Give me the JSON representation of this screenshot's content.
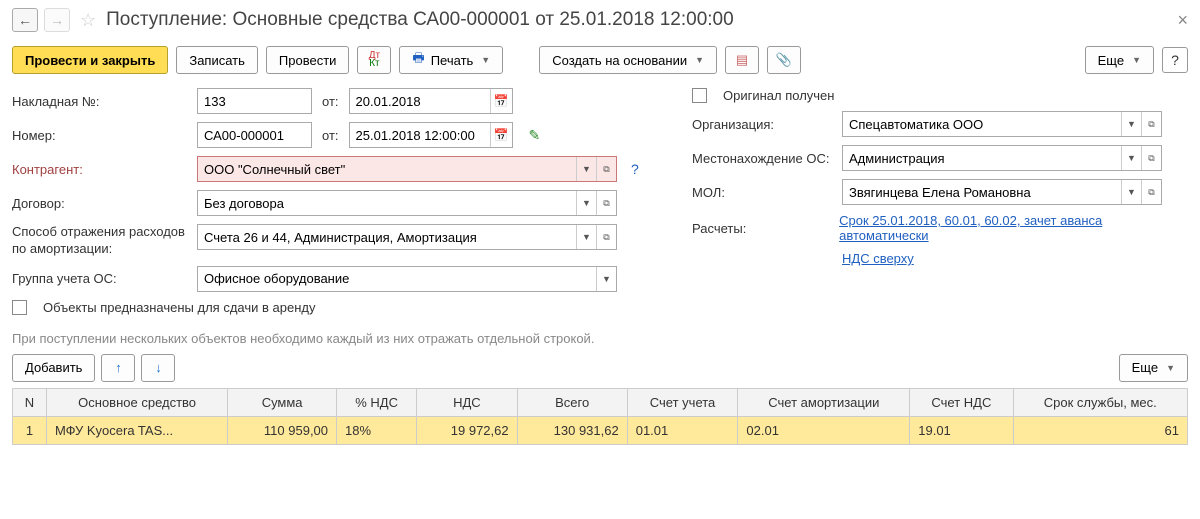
{
  "header": {
    "title": "Поступление: Основные средства СА00-000001 от 25.01.2018 12:00:00"
  },
  "toolbar": {
    "postClose": "Провести и закрыть",
    "save": "Записать",
    "post": "Провести",
    "print": "Печать",
    "createBased": "Создать на основании",
    "more": "Еще"
  },
  "form": {
    "invoiceLabel": "Накладная №:",
    "invoiceNo": "133",
    "fromLabel": "от:",
    "invoiceDate": "20.01.2018",
    "numberLabel": "Номер:",
    "number": "СА00-000001",
    "docDate": "25.01.2018 12:00:00",
    "contractorLabel": "Контрагент:",
    "contractor": "ООО \"Солнечный свет\"",
    "contractLabel": "Договор:",
    "contract": "Без договора",
    "expenseMethodLabel": "Способ отражения расходов по амортизации:",
    "expenseMethod": "Счета 26 и 44, Администрация, Амортизация",
    "osGroupLabel": "Группа учета ОС:",
    "osGroup": "Офисное оборудование",
    "rentCheckbox": "Объекты предназначены для сдачи в аренду",
    "originalLabel": "Оригинал получен",
    "orgLabel": "Организация:",
    "org": "Спецавтоматика ООО",
    "locationLabel": "Местонахождение ОС:",
    "location": "Администрация",
    "molLabel": "МОЛ:",
    "mol": "Звягинцева Елена Романовна",
    "calcLabel": "Расчеты:",
    "calcLink": "Срок 25.01.2018, 60.01, 60.02, зачет аванса автоматически",
    "vatLink": "НДС сверху"
  },
  "hint": "При поступлении нескольких объектов необходимо каждый из них отражать отдельной строкой.",
  "rowToolbar": {
    "add": "Добавить",
    "more": "Еще"
  },
  "table": {
    "headers": {
      "n": "N",
      "asset": "Основное средство",
      "sum": "Сумма",
      "vatPct": "% НДС",
      "vat": "НДС",
      "total": "Всего",
      "acc": "Счет учета",
      "accAmort": "Счет амортизации",
      "accVat": "Счет НДС",
      "life": "Срок службы, мес."
    },
    "rows": [
      {
        "n": "1",
        "asset": "МФУ Kyocera TAS...",
        "sum": "110 959,00",
        "vatPct": "18%",
        "vat": "19 972,62",
        "total": "130 931,62",
        "acc": "01.01",
        "accAmort": "02.01",
        "accVat": "19.01",
        "life": "61"
      }
    ]
  }
}
